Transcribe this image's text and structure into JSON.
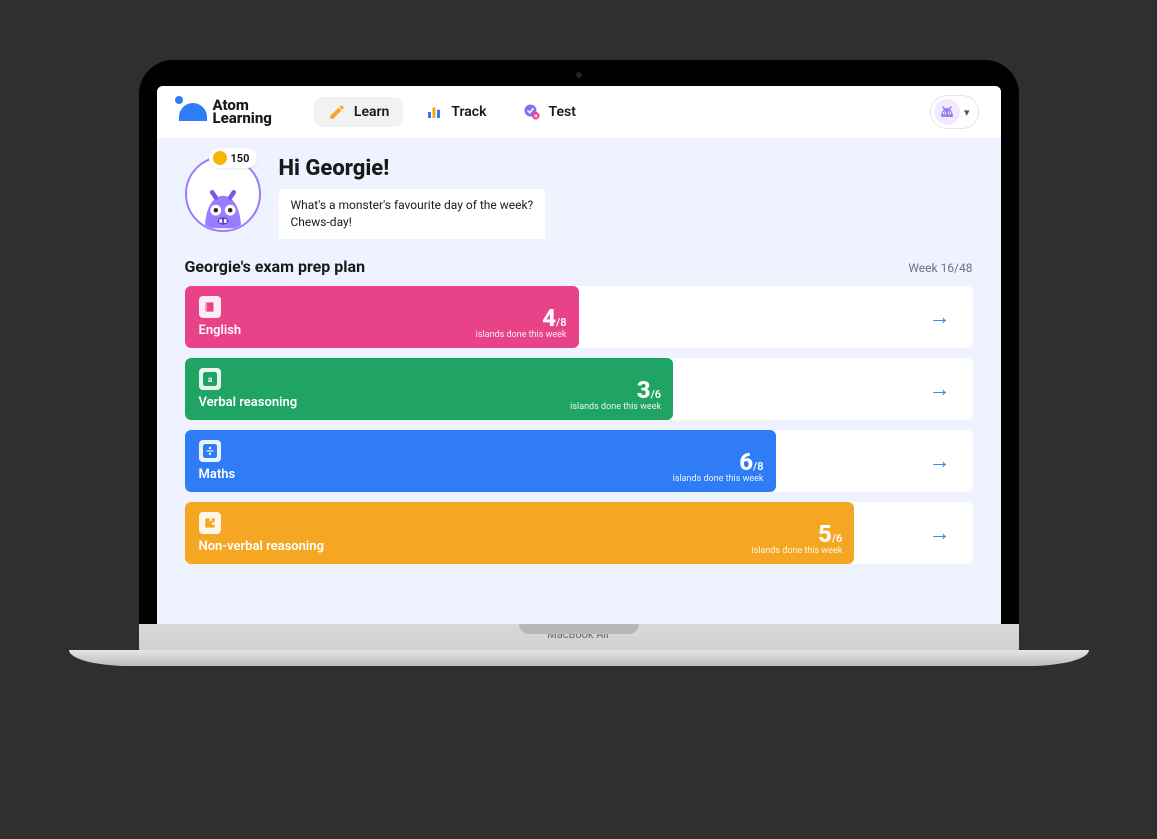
{
  "device_label": "MacBook Air",
  "brand": {
    "line1": "Atom",
    "line2": "Learning"
  },
  "nav": {
    "learn": "Learn",
    "track": "Track",
    "test": "Test"
  },
  "coins": "150",
  "greeting": "Hi Georgie!",
  "joke_line1": "What's a monster's favourite day of the week?",
  "joke_line2": "Chews-day!",
  "plan_title": "Georgie's exam prep plan",
  "week_label": "Week 16/48",
  "islands_caption": "islands done this week",
  "subjects": [
    {
      "name": "English",
      "done": "4",
      "total": "/8",
      "color": "#e84288",
      "widthPct": 50,
      "icon": "book"
    },
    {
      "name": "Verbal reasoning",
      "done": "3",
      "total": "/6",
      "color": "#1fa463",
      "widthPct": 62,
      "icon": "letter"
    },
    {
      "name": "Maths",
      "done": "6",
      "total": "/8",
      "color": "#2f7cf6",
      "widthPct": 75,
      "icon": "divide"
    },
    {
      "name": "Non-verbal reasoning",
      "done": "5",
      "total": "/6",
      "color": "#f5a623",
      "widthPct": 85,
      "icon": "puzzle"
    }
  ]
}
